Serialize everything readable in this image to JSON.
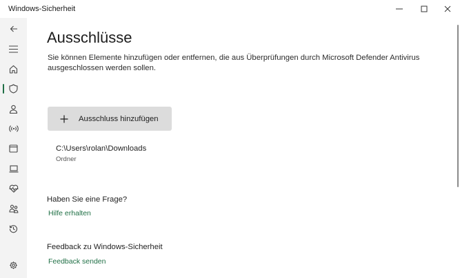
{
  "window": {
    "title": "Windows-Sicherheit",
    "controls": [
      "minimize",
      "maximize",
      "close"
    ]
  },
  "sidebar": {
    "items": [
      {
        "icon": "back-arrow-icon"
      },
      {
        "icon": "hamburger-menu-icon"
      },
      {
        "icon": "home-icon"
      },
      {
        "icon": "shield-icon",
        "active": true
      },
      {
        "icon": "person-icon"
      },
      {
        "icon": "wireless-icon"
      },
      {
        "icon": "app-browser-icon"
      },
      {
        "icon": "laptop-icon"
      },
      {
        "icon": "heart-pulse-icon"
      },
      {
        "icon": "family-icon"
      },
      {
        "icon": "history-icon"
      },
      {
        "icon": "settings-gear-icon"
      }
    ],
    "accent": "#1f6f45"
  },
  "main": {
    "heading": "Ausschlüsse",
    "description": "Sie können Elemente hinzufügen oder entfernen, die aus Überprüfungen durch Microsoft Defender Antivirus ausgeschlossen werden sollen.",
    "add_button_label": "Ausschluss hinzufügen",
    "exclusions": [
      {
        "path": "C:\\Users\\rolan\\Downloads",
        "type": "Ordner"
      }
    ],
    "question": {
      "heading": "Haben Sie eine Frage?",
      "link": "Hilfe erhalten"
    },
    "feedback": {
      "heading": "Feedback zu Windows-Sicherheit",
      "link": "Feedback senden"
    }
  }
}
